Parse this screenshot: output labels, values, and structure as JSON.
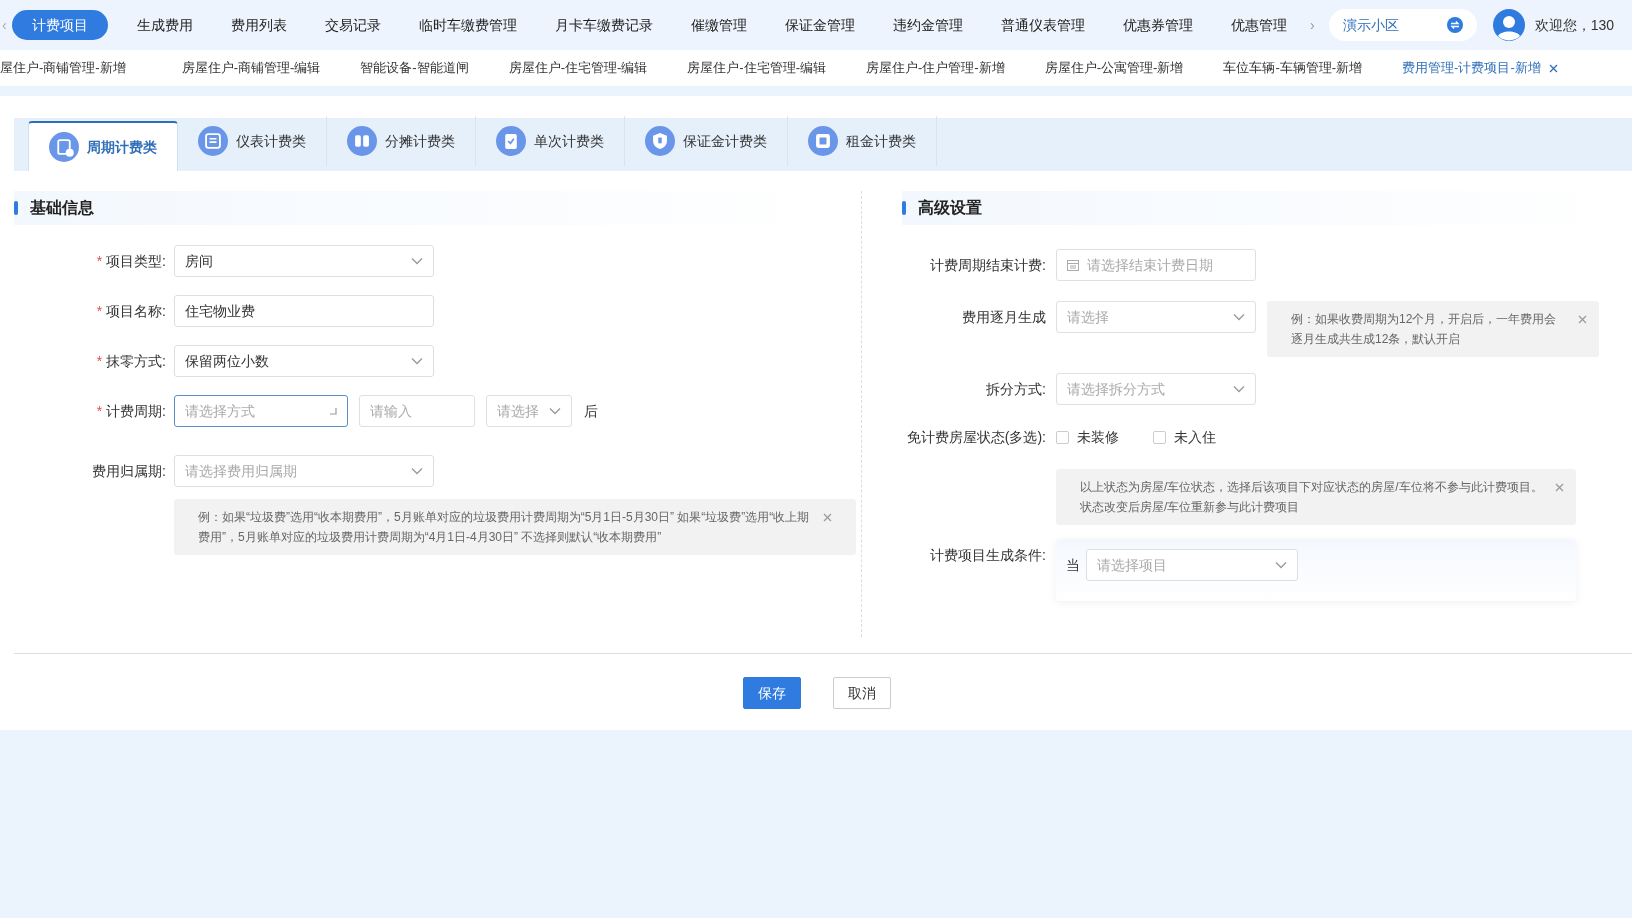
{
  "nav": {
    "items": [
      {
        "label": "计费项目",
        "selected": true
      },
      {
        "label": "生成费用",
        "selected": false
      },
      {
        "label": "费用列表",
        "selected": false
      },
      {
        "label": "交易记录",
        "selected": false
      },
      {
        "label": "临时车缴费管理",
        "selected": false
      },
      {
        "label": "月卡车缴费记录",
        "selected": false
      },
      {
        "label": "催缴管理",
        "selected": false
      },
      {
        "label": "保证金管理",
        "selected": false
      },
      {
        "label": "违约金管理",
        "selected": false
      },
      {
        "label": "普通仪表管理",
        "selected": false
      },
      {
        "label": "优惠券管理",
        "selected": false
      },
      {
        "label": "优惠管理",
        "selected": false
      }
    ],
    "scroll_left": "‹",
    "scroll_right": "›",
    "community": "演示小区",
    "welcome": "欢迎您，130"
  },
  "tags": [
    {
      "label": "屋住户-商铺管理-新增",
      "selected": false
    },
    {
      "label": "房屋住户-商铺管理-编辑",
      "selected": false
    },
    {
      "label": "智能设备-智能道闸",
      "selected": false
    },
    {
      "label": "房屋住户-住宅管理-编辑",
      "selected": false
    },
    {
      "label": "房屋住户-住宅管理-编辑",
      "selected": false
    },
    {
      "label": "房屋住户-住户管理-新增",
      "selected": false
    },
    {
      "label": "房屋住户-公寓管理-新增",
      "selected": false
    },
    {
      "label": "车位车辆-车辆管理-新增",
      "selected": false
    },
    {
      "label": "费用管理-计费项目-新增",
      "selected": true
    }
  ],
  "category_tabs": [
    {
      "label": "周期计费类",
      "selected": true
    },
    {
      "label": "仪表计费类",
      "selected": false
    },
    {
      "label": "分摊计费类",
      "selected": false
    },
    {
      "label": "单次计费类",
      "selected": false
    },
    {
      "label": "保证金计费类",
      "selected": false
    },
    {
      "label": "租金计费类",
      "selected": false
    }
  ],
  "basic_info": {
    "title": "基础信息",
    "fields": [
      {
        "kind": "select",
        "label": "项目类型:",
        "required_mark": "*",
        "value": "房间"
      },
      {
        "kind": "input",
        "label": "项目名称:",
        "required_mark": "*",
        "value": "住宅物业费"
      },
      {
        "kind": "select",
        "label": "抹零方式:",
        "required_mark": "*",
        "value": "保留两位小数"
      },
      {
        "kind": "period",
        "label": "计费周期:",
        "required_mark": "*",
        "placeholder": "请选择方式",
        "number_placeholder": "请输入",
        "unit_placeholder": "请选择",
        "suffix": "后"
      },
      {
        "kind": "select",
        "label": "费用归属期:",
        "placeholder": "请选择费用归属期"
      }
    ],
    "note": "例：如果“垃圾费”选用“收本期费用”，5月账单对应的垃圾费用计费周期为“5月1日-5月30日” 如果“垃圾费”选用“收上期费用”，5月账单对应的垃圾费用计费周期为“4月1日-4月30日” 不选择则默认“收本期费用”"
  },
  "advanced": {
    "title": "高级设置",
    "fields": [
      {
        "kind": "date",
        "label": "计费周期结束计费:",
        "placeholder": "请选择结束计费日期"
      },
      {
        "kind": "select",
        "label": "费用逐月生成",
        "placeholder": "请选择",
        "note": "例：如果收费周期为12个月，开启后，一年费用会逐月生成共生成12条，默认开启"
      },
      {
        "kind": "select",
        "label": "拆分方式:",
        "placeholder": "请选择拆分方式"
      },
      {
        "kind": "checkboxes",
        "label": "免计费房屋状态(多选):",
        "options": [
          {
            "label": "未装修",
            "checked": false
          },
          {
            "label": "未入住",
            "checked": false
          }
        ],
        "note": "以上状态为房屋/车位状态，选择后该项目下对应状态的房屋/车位将不参与此计费项目。状态改变后房屋/车位重新参与此计费项目"
      },
      {
        "kind": "condition",
        "label": "计费项目生成条件:",
        "prefix": "当",
        "placeholder": "请选择项目"
      }
    ]
  },
  "buttons": [
    {
      "label": "保存",
      "kind": "primary"
    },
    {
      "label": "取消",
      "kind": "default"
    }
  ]
}
